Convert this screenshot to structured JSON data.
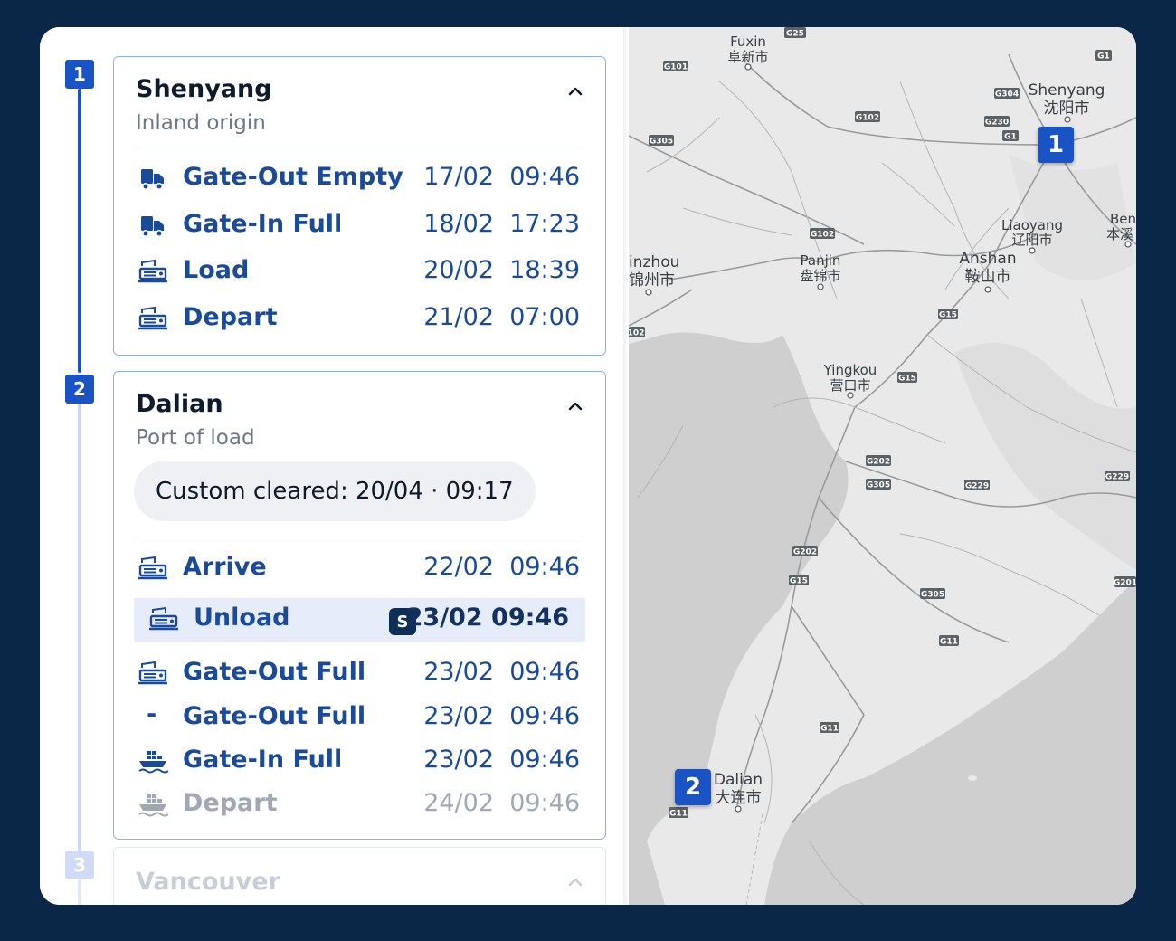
{
  "stops": [
    {
      "number": "1",
      "title": "Shenyang",
      "subtitle": "Inland origin",
      "events": [
        {
          "icon": "truck-icon",
          "label": "Gate-Out Empty",
          "date": "17/02",
          "time": "09:46"
        },
        {
          "icon": "truck-icon",
          "label": "Gate-In Full",
          "date": "18/02",
          "time": "17:23"
        },
        {
          "icon": "rail-icon",
          "label": "Load",
          "date": "20/02",
          "time": "18:39"
        },
        {
          "icon": "rail-icon",
          "label": "Depart",
          "date": "21/02",
          "time": "07:00"
        }
      ]
    },
    {
      "number": "2",
      "title": "Dalian",
      "subtitle": "Port of load",
      "custom_cleared": "Custom cleared: 20/04 · 09:17",
      "events": [
        {
          "icon": "rail-icon",
          "label": "Arrive",
          "date": "22/02",
          "time": "09:46"
        },
        {
          "icon": "rail-icon",
          "label": "Unload",
          "date": "23/02",
          "time": "09:46",
          "badge": "S",
          "highlighted": true
        },
        {
          "icon": "rail-icon",
          "label": "Gate-Out Full",
          "date": "23/02",
          "time": "09:46"
        },
        {
          "icon": "dash-icon",
          "label": "Gate-Out Full",
          "date": "23/02",
          "time": "09:46",
          "glyph": "-"
        },
        {
          "icon": "vessel-icon",
          "label": "Gate-In Full",
          "date": "23/02",
          "time": "09:46"
        },
        {
          "icon": "vessel-icon",
          "label": "Depart",
          "date": "24/02",
          "time": "09:46",
          "muted": true
        }
      ]
    },
    {
      "number": "3",
      "title": "Vancouver"
    }
  ],
  "map": {
    "cities": [
      {
        "en": "Fuxin",
        "zh": "阜新市"
      },
      {
        "en": "Shenyang",
        "zh": "沈阳市"
      },
      {
        "en": "Liaoyang",
        "zh": "辽阳市"
      },
      {
        "en": "Anshan",
        "zh": "鞍山市"
      },
      {
        "en": "Panjin",
        "zh": "盘锦市"
      },
      {
        "en": "inzhou",
        "zh": "锦州市"
      },
      {
        "en": "Yingkou",
        "zh": "营口市"
      },
      {
        "en": "Ben",
        "zh": "本溪"
      },
      {
        "en": "Dalian",
        "zh": "大连市"
      }
    ],
    "roads": [
      "G25",
      "G101",
      "G1",
      "G304",
      "G230",
      "G102",
      "G305",
      "G102",
      "G15",
      "G15",
      "G202",
      "G305",
      "G229",
      "G229",
      "G202",
      "G15",
      "G305",
      "G201",
      "G11",
      "G11",
      "G11",
      "102"
    ],
    "pins": [
      "1",
      "2"
    ]
  },
  "colors": {
    "frame": "#0b2748",
    "accent": "#1a53c4",
    "event_text": "#1a4a9a",
    "highlight_bg": "#e6ecfa",
    "badge_bg": "#0d2e57"
  }
}
